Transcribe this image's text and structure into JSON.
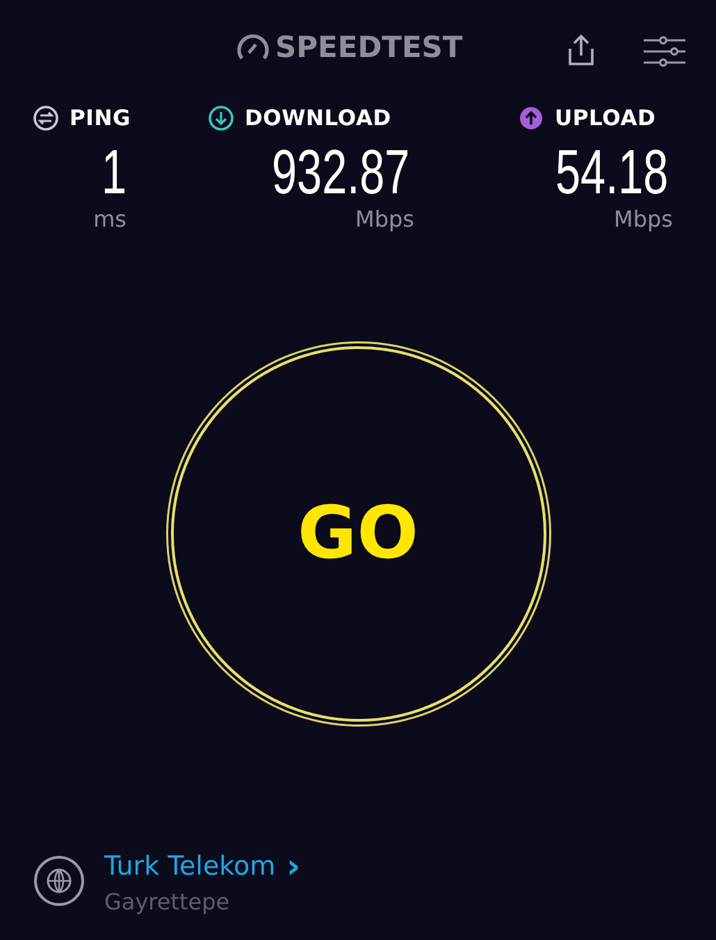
{
  "header": {
    "logo": "SPEEDTEST"
  },
  "metrics": [
    {
      "kind": "ping",
      "label": "PING",
      "value": "1",
      "unit": "ms",
      "color": "#c8c8d0"
    },
    {
      "kind": "download",
      "label": "DOWNLOAD",
      "value": "932.87",
      "unit": "Mbps",
      "color": "#35c6c0"
    },
    {
      "kind": "upload",
      "label": "UPLOAD",
      "value": "54.18",
      "unit": "Mbps",
      "color": "#a35ed8"
    }
  ],
  "go_button": {
    "label": "GO"
  },
  "provider": {
    "name": "Turk Telekom",
    "chevron": "›",
    "location": "Gayrettepe"
  }
}
